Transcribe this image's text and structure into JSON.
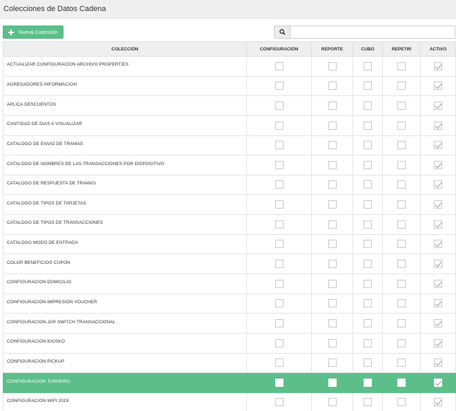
{
  "header": {
    "title": "Colecciones de Datos Cadena"
  },
  "toolbar": {
    "new_label": "Nueva Colección",
    "search_placeholder": ""
  },
  "colors": {
    "accent": "#5cbf8a",
    "header_bg": "#efefef",
    "border": "#e4e4e4"
  },
  "table": {
    "columns": [
      "COLECCIÓN",
      "CONFIGURACIÓN",
      "REPORTE",
      "CUBO",
      "REPETIR",
      "ACTIVO"
    ],
    "rows": [
      {
        "name": "ACTUALIZAR CONFIGURACION ARCHIVO PROPERTIES",
        "configuracion": false,
        "reporte": false,
        "cubo": false,
        "repetir": false,
        "activo": true,
        "selected": false
      },
      {
        "name": "AGREGADORES INFORMACION",
        "configuracion": false,
        "reporte": false,
        "cubo": false,
        "repetir": false,
        "activo": true,
        "selected": false
      },
      {
        "name": "APLICA DESCUENTOS",
        "configuracion": false,
        "reporte": false,
        "cubo": false,
        "repetir": false,
        "activo": true,
        "selected": false
      },
      {
        "name": "CANTIDAD DE DIAS A VISUALIZAR",
        "configuracion": false,
        "reporte": false,
        "cubo": false,
        "repetir": false,
        "activo": true,
        "selected": false
      },
      {
        "name": "CATALOGO DE ENVIO DE TRAMAS",
        "configuracion": false,
        "reporte": false,
        "cubo": false,
        "repetir": false,
        "activo": true,
        "selected": false
      },
      {
        "name": "CATALOGO DE NOMBRES DE LAS TRANSACCIONES POR DISPOSITIVO",
        "configuracion": false,
        "reporte": false,
        "cubo": false,
        "repetir": false,
        "activo": true,
        "selected": false
      },
      {
        "name": "CATALOGO DE RESPUESTA DE TRAMAS",
        "configuracion": false,
        "reporte": false,
        "cubo": false,
        "repetir": false,
        "activo": true,
        "selected": false
      },
      {
        "name": "CATALOGO DE TIPOS DE TARJETAS",
        "configuracion": false,
        "reporte": false,
        "cubo": false,
        "repetir": false,
        "activo": true,
        "selected": false
      },
      {
        "name": "CATALOGO DE TIPOS DE TRANSACCIONES",
        "configuracion": false,
        "reporte": false,
        "cubo": false,
        "repetir": false,
        "activo": true,
        "selected": false
      },
      {
        "name": "CATALOGO MODO DE ENTRADA",
        "configuracion": false,
        "reporte": false,
        "cubo": false,
        "repetir": false,
        "activo": true,
        "selected": false
      },
      {
        "name": "COLOR BENEFICIOS CUPON",
        "configuracion": false,
        "reporte": false,
        "cubo": false,
        "repetir": false,
        "activo": true,
        "selected": false
      },
      {
        "name": "CONFIGURACION DOMICILIO",
        "configuracion": false,
        "reporte": false,
        "cubo": false,
        "repetir": false,
        "activo": true,
        "selected": false
      },
      {
        "name": "CONFIGURACION IMPRESION VOUCHER",
        "configuracion": false,
        "reporte": false,
        "cubo": false,
        "repetir": false,
        "activo": true,
        "selected": false
      },
      {
        "name": "CONFIGURACION JAR SWITCH TRANSACCIONAL",
        "configuracion": false,
        "reporte": false,
        "cubo": false,
        "repetir": false,
        "activo": true,
        "selected": false
      },
      {
        "name": "CONFIGURACION KIOSKO",
        "configuracion": false,
        "reporte": false,
        "cubo": false,
        "repetir": false,
        "activo": true,
        "selected": false
      },
      {
        "name": "CONFIGURACION PICKUP",
        "configuracion": false,
        "reporte": false,
        "cubo": false,
        "repetir": false,
        "activo": true,
        "selected": false
      },
      {
        "name": "CONFIGURACION TURNERO",
        "configuracion": false,
        "reporte": false,
        "cubo": false,
        "repetir": false,
        "activo": true,
        "selected": true
      },
      {
        "name": "CONFIGURACION WIFI 2019",
        "configuracion": false,
        "reporte": false,
        "cubo": false,
        "repetir": false,
        "activo": true,
        "selected": false
      }
    ]
  }
}
